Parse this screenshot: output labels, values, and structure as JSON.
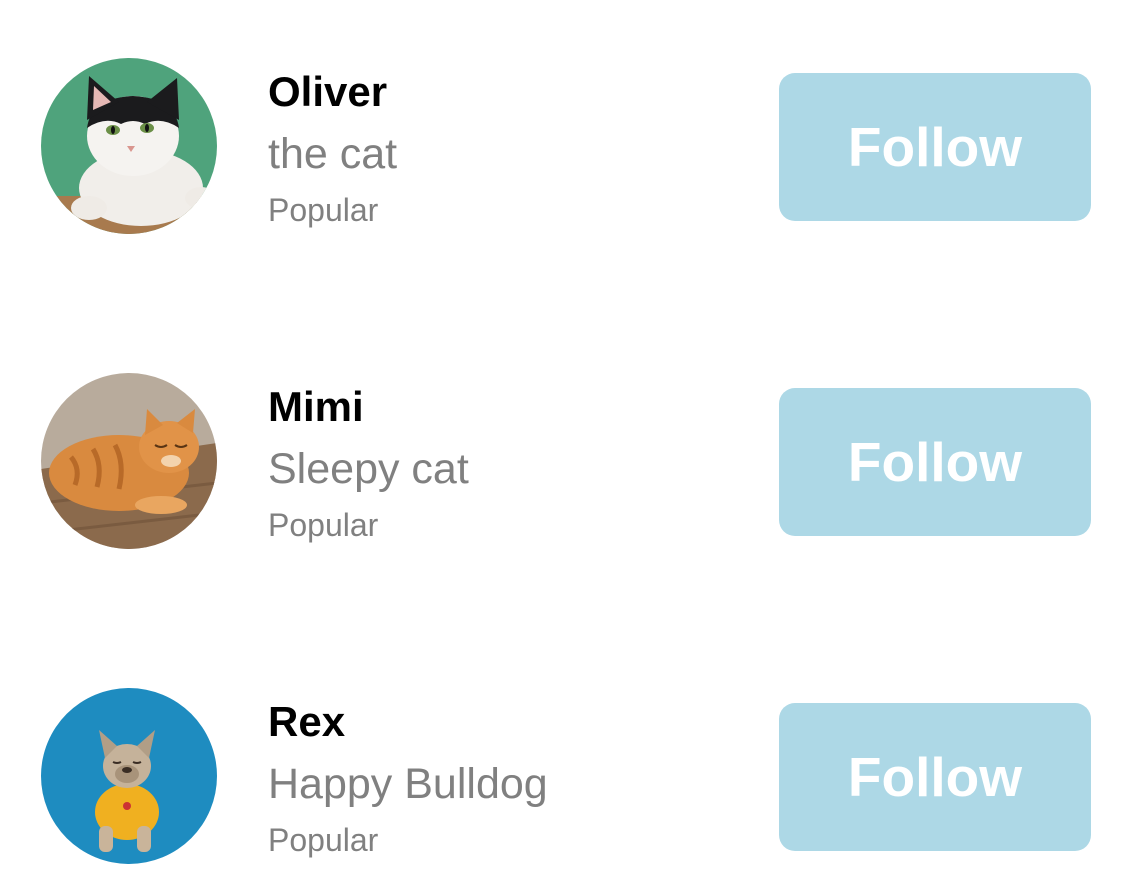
{
  "colors": {
    "accent_button": "#add8e6",
    "button_text": "#ffffff",
    "name_text": "#000000",
    "secondary_text": "#808080"
  },
  "users": [
    {
      "name": "Oliver",
      "tagline": "the cat",
      "badge": "Popular",
      "follow_label": "Follow",
      "avatar": "black-and-white-cat-photo"
    },
    {
      "name": "Mimi",
      "tagline": "Sleepy cat",
      "badge": "Popular",
      "follow_label": "Follow",
      "avatar": "orange-tabby-cat-photo"
    },
    {
      "name": "Rex",
      "tagline": "Happy Bulldog",
      "badge": "Popular",
      "follow_label": "Follow",
      "avatar": "french-bulldog-photo"
    }
  ]
}
